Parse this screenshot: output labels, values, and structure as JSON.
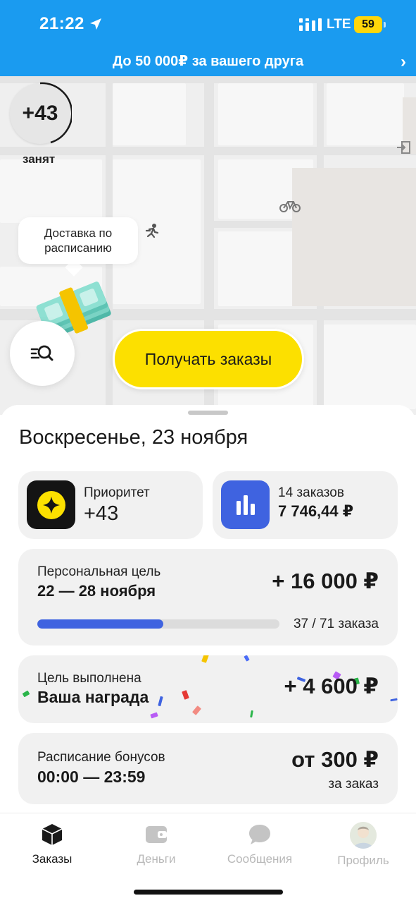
{
  "status_bar": {
    "time": "21:22",
    "network": "LTE",
    "battery": "59",
    "icons": [
      "location-arrow-icon",
      "signal-icon"
    ]
  },
  "promo": {
    "text": "До 50 000₽ за вашего друга",
    "chevron": "›"
  },
  "map": {
    "priority_value": "+43",
    "status_label": "занят",
    "bubble_text": "Доставка по расписанию",
    "get_orders_label": "Получать заказы",
    "icons": [
      "money-stack-icon",
      "courier-icon",
      "bicycle-icon",
      "exit-icon",
      "search-list-icon"
    ]
  },
  "sheet": {
    "date_title": "Воскресенье, 23 ноября",
    "priority_card": {
      "label": "Приоритет",
      "value": "+43"
    },
    "orders_card": {
      "label": "14 заказов",
      "value": "7 746,44 ₽"
    },
    "goal_card": {
      "label": "Персональная цель",
      "dates": "22 — 28 ноября",
      "amount": "+ 16 000 ₽",
      "progress_text": "37 / 71 заказа",
      "progress_done": 37,
      "progress_total": 71
    },
    "reward_card": {
      "label": "Цель выполнена",
      "title": "Ваша награда",
      "amount": "+ 4 600 ₽"
    },
    "schedule_card": {
      "label": "Расписание бонусов",
      "time": "00:00 — 23:59",
      "amount": "от 300 ₽",
      "sub": "за заказ"
    }
  },
  "tabs": [
    {
      "label": "Заказы",
      "icon": "cube-icon",
      "active": true
    },
    {
      "label": "Деньги",
      "icon": "wallet-icon",
      "active": false
    },
    {
      "label": "Сообщения",
      "icon": "chat-icon",
      "active": false
    },
    {
      "label": "Профиль",
      "icon": "avatar",
      "active": false
    }
  ],
  "colors": {
    "topbar": "#1a9bf0",
    "accent_yellow": "#fce000",
    "accent_blue": "#3f63e0",
    "card_bg": "#f1f1f1"
  }
}
